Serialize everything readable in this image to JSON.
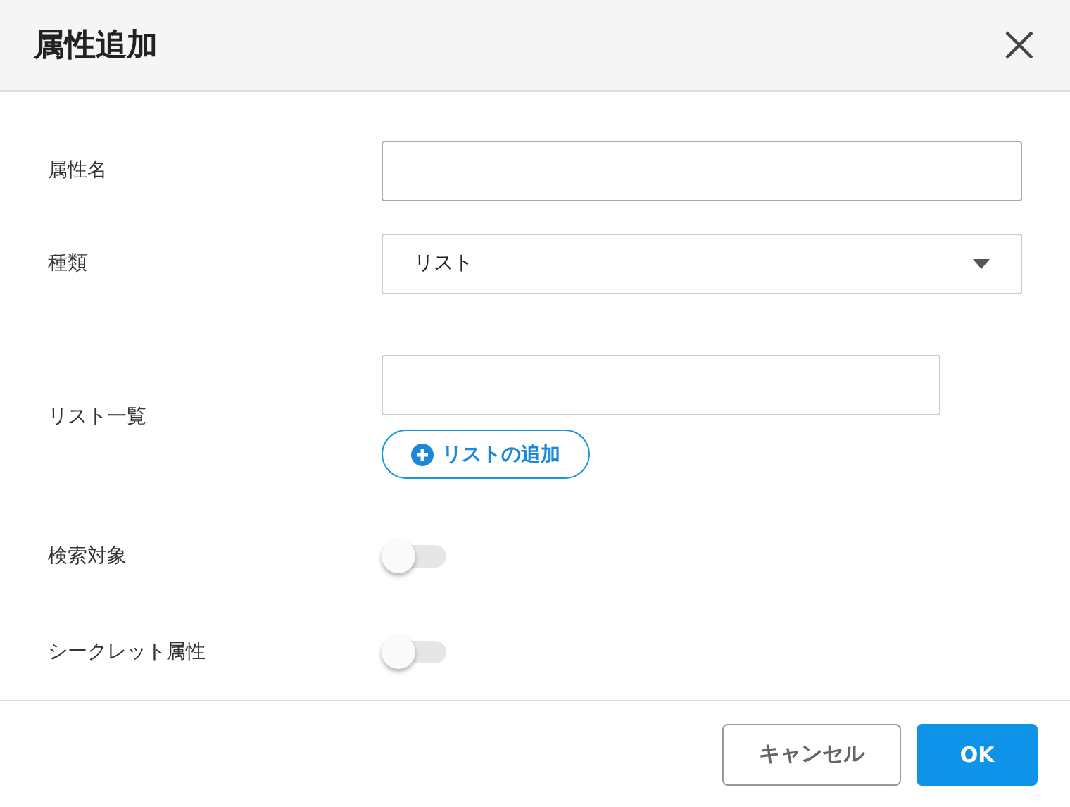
{
  "dialog": {
    "title": "属性追加"
  },
  "rows": [
    {
      "kind": "text",
      "label": "属性名"
    },
    {
      "kind": "select",
      "label": "種類",
      "value": "リスト"
    },
    {
      "kind": "list",
      "label": "リスト一覧",
      "add_button": "リストの追加"
    },
    {
      "kind": "toggle",
      "label": "検索対象",
      "on": false
    },
    {
      "kind": "toggle",
      "label": "シークレット属性",
      "on": false
    }
  ],
  "buttons": [
    {
      "kind": "secondary",
      "label": "キャンセル"
    },
    {
      "kind": "primary",
      "label": "OK"
    }
  ]
}
